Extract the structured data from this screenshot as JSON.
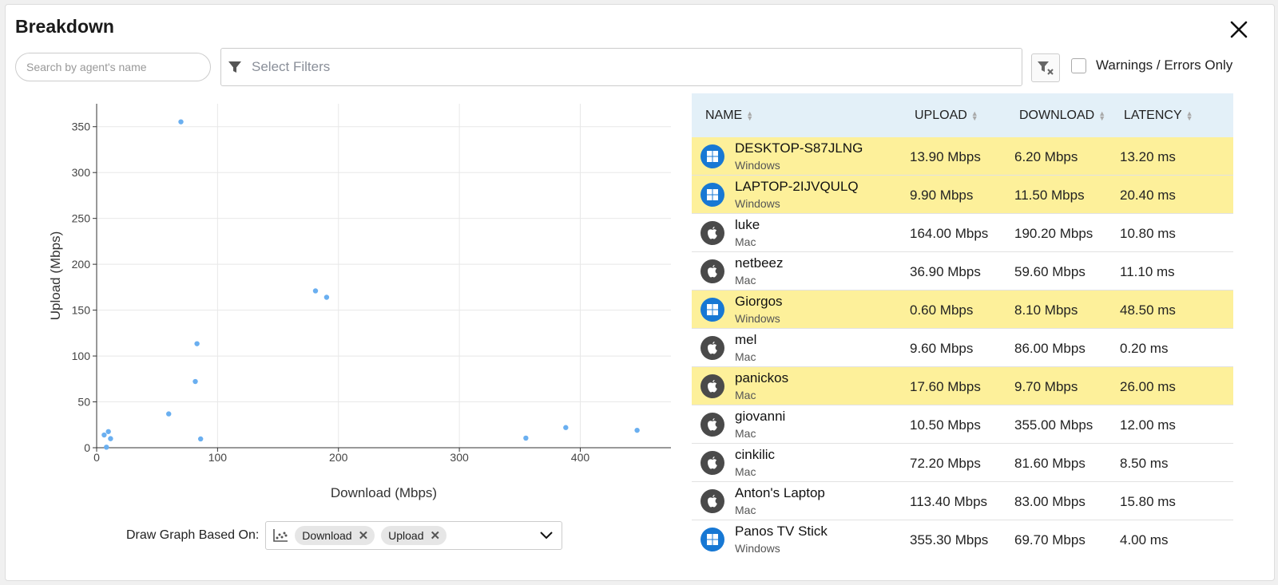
{
  "header": {
    "title": "Breakdown"
  },
  "search": {
    "placeholder": "Search by agent's name"
  },
  "filters": {
    "placeholder": "Select Filters"
  },
  "warnings": {
    "label": "Warnings / Errors Only"
  },
  "graph_control": {
    "label": "Draw Graph Based On:",
    "chips": [
      "Download",
      "Upload"
    ]
  },
  "table": {
    "headers": {
      "name": "NAME",
      "upload": "UPLOAD",
      "download": "DOWNLOAD",
      "latency": "LATENCY"
    },
    "rows": [
      {
        "name": "DESKTOP-S87JLNG",
        "os": "Windows",
        "upload": "13.90 Mbps",
        "download": "6.20 Mbps",
        "latency": "13.20 ms",
        "highlight": true
      },
      {
        "name": "LAPTOP-2IJVQULQ",
        "os": "Windows",
        "upload": "9.90 Mbps",
        "download": "11.50 Mbps",
        "latency": "20.40 ms",
        "highlight": true
      },
      {
        "name": "luke",
        "os": "Mac",
        "upload": "164.00 Mbps",
        "download": "190.20 Mbps",
        "latency": "10.80 ms",
        "highlight": false
      },
      {
        "name": "netbeez",
        "os": "Mac",
        "upload": "36.90 Mbps",
        "download": "59.60 Mbps",
        "latency": "11.10 ms",
        "highlight": false
      },
      {
        "name": "Giorgos",
        "os": "Windows",
        "upload": "0.60 Mbps",
        "download": "8.10 Mbps",
        "latency": "48.50 ms",
        "highlight": true
      },
      {
        "name": "mel",
        "os": "Mac",
        "upload": "9.60 Mbps",
        "download": "86.00 Mbps",
        "latency": "0.20 ms",
        "highlight": false
      },
      {
        "name": "panickos",
        "os": "Mac",
        "upload": "17.60 Mbps",
        "download": "9.70 Mbps",
        "latency": "26.00 ms",
        "highlight": true
      },
      {
        "name": "giovanni",
        "os": "Mac",
        "upload": "10.50 Mbps",
        "download": "355.00 Mbps",
        "latency": "12.00 ms",
        "highlight": false
      },
      {
        "name": "cinkilic",
        "os": "Mac",
        "upload": "72.20 Mbps",
        "download": "81.60 Mbps",
        "latency": "8.50 ms",
        "highlight": false
      },
      {
        "name": "Anton's Laptop",
        "os": "Mac",
        "upload": "113.40 Mbps",
        "download": "83.00 Mbps",
        "latency": "15.80 ms",
        "highlight": false
      },
      {
        "name": "Panos TV Stick",
        "os": "Windows",
        "upload": "355.30 Mbps",
        "download": "69.70 Mbps",
        "latency": "4.00 ms",
        "highlight": false
      }
    ]
  },
  "colors": {
    "highlight": "#fdf09a",
    "header_bg": "#e3f0f8",
    "point": "#6aaff0",
    "windows": "#1778d4",
    "mac": "#4a4a4a"
  },
  "chart_data": {
    "type": "scatter",
    "xlabel": "Download (Mbps)",
    "ylabel": "Upload (Mbps)",
    "xlim": [
      0,
      475
    ],
    "ylim": [
      0,
      375
    ],
    "xticks": [
      0,
      100,
      200,
      300,
      400
    ],
    "yticks": [
      0,
      50,
      100,
      150,
      200,
      250,
      300,
      350
    ],
    "grid": true,
    "points": [
      {
        "x": 6.2,
        "y": 13.9
      },
      {
        "x": 11.5,
        "y": 9.9
      },
      {
        "x": 190.2,
        "y": 164.0
      },
      {
        "x": 59.6,
        "y": 36.9
      },
      {
        "x": 8.1,
        "y": 0.6
      },
      {
        "x": 86.0,
        "y": 9.6
      },
      {
        "x": 9.7,
        "y": 17.6
      },
      {
        "x": 355.0,
        "y": 10.5
      },
      {
        "x": 81.6,
        "y": 72.2
      },
      {
        "x": 83.0,
        "y": 113.4
      },
      {
        "x": 69.7,
        "y": 355.3
      },
      {
        "x": 181.0,
        "y": 171.0
      },
      {
        "x": 388.0,
        "y": 22.0
      },
      {
        "x": 447.0,
        "y": 19.0
      }
    ]
  }
}
